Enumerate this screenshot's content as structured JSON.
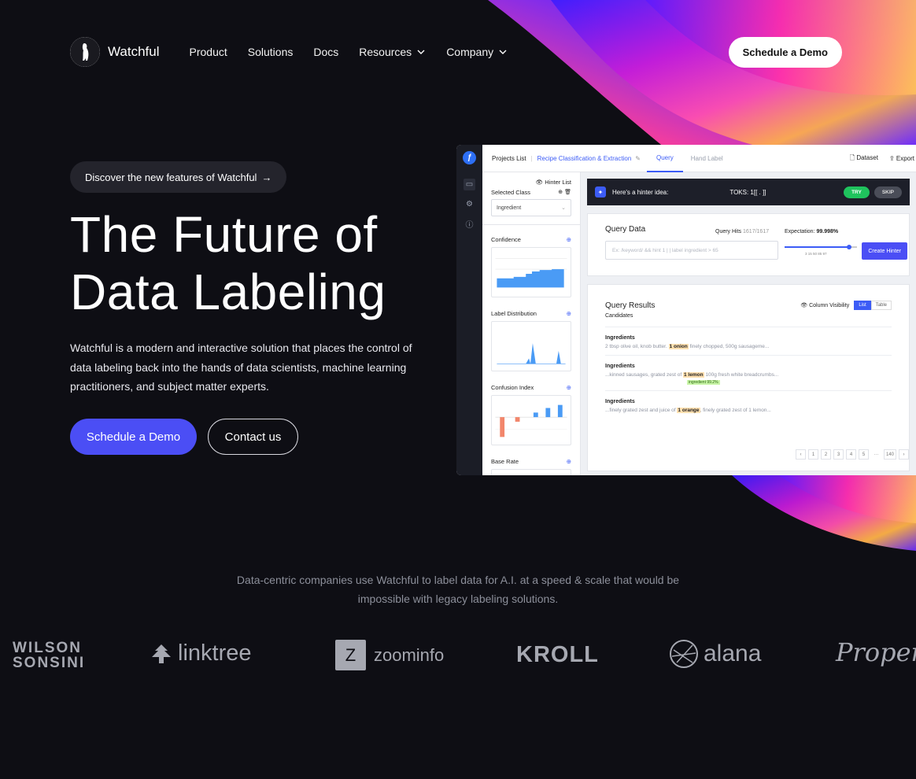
{
  "nav": {
    "brand": "Watchful",
    "items": [
      "Product",
      "Solutions",
      "Docs",
      "Resources",
      "Company"
    ],
    "cta": "Schedule a Demo"
  },
  "hero": {
    "pill": "Discover the new features of Watchful",
    "pill_arrow": "→",
    "title_line1": "The Future of",
    "title_line2": "Data Labeling",
    "subtitle": "Watchful is a modern and interactive solution that places the control of data labeling back into the hands of data scientists, machine learning practitioners, and subject matter experts.",
    "primary_cta": "Schedule a Demo",
    "secondary_cta": "Contact us"
  },
  "app": {
    "crumb_projects": "Projects List",
    "crumb_project": "Recipe Classification & Extraction",
    "tab_query": "Query",
    "tab_hand": "Hand Label",
    "dataset": "Dataset",
    "export": "Export",
    "hinter_list": "Hinter List",
    "selected_class": "Selected Class",
    "class_value": "Ingredient",
    "confidence": "Confidence",
    "label_distribution": "Label Distribution",
    "confusion_index": "Confusion Index",
    "base_rate": "Base Rate",
    "hinter_idea": "Here's a hinter idea:",
    "toks": "TOKS: 1[[ . ]]",
    "try": "TRY",
    "skip": "SKIP",
    "query_data": "Query Data",
    "query_hits_label": "Query Hits",
    "query_hits_value": "1617/1617",
    "expectation_label": "Expectation:",
    "expectation_value": "99.998%",
    "query_placeholder": "Ex: /keyword/ && hint 1 | | label ingredient > 65",
    "slider_ticks": "3  15  50  85  97",
    "create_hinter": "Create Hinter",
    "query_results": "Query Results",
    "candidates": "Candidates",
    "column_visibility": "Column Visibility",
    "view_list": "List",
    "view_table": "Table",
    "results": [
      {
        "heading": "Ingredients",
        "pre": "2 tbsp olive oil, knob butter. ",
        "hl": "1 onion",
        "post": " finely chopped, 500g sausageme..."
      },
      {
        "heading": "Ingredients",
        "pre": "...kinned sausages, grated zest of ",
        "hl": "1  lemon",
        "post": " 100g fresh white breadcrumbs...",
        "tag": "ingredient 99.2%"
      },
      {
        "heading": "Ingredients",
        "pre": "...finely grated  zest and juice of ",
        "hl": "1 orange",
        "post": ", finely grated zest of 1 lemon..."
      }
    ],
    "pages": [
      "‹",
      "1",
      "2",
      "3",
      "4",
      "5",
      "···",
      "140",
      "›"
    ]
  },
  "logos": {
    "tagline": "Data-centric companies use Watchful to label data for A.I. at a speed & scale that would be impossible with legacy labeling solutions.",
    "wilson_line1": "WILSON",
    "wilson_line2": "SONSINI",
    "linktree": "linktree",
    "zoominfo": "zoominfo",
    "zoominfo_mark": "Z",
    "kroll": "KROLL",
    "alana": "alana",
    "proper": "Proper"
  },
  "colors": {
    "background": "#0e0e14",
    "accent": "#4b4ef5",
    "app_accent": "#3c5cf6"
  }
}
